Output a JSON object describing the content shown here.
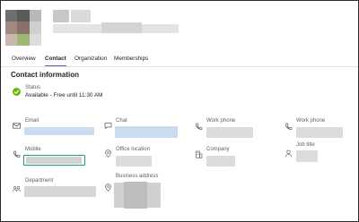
{
  "header": {
    "avatar": {
      "blur_colors": [
        "#6f6f6f",
        "#5a5a5a",
        "#b8b8b8",
        "#a08a80",
        "#8a6f6a",
        "#cfcfcf",
        "#c7b7ad",
        "#9db872",
        "#dcdcdc"
      ]
    },
    "name_blur_color": "#cccccc"
  },
  "tabs": [
    {
      "label": "Overview"
    },
    {
      "label": "Contact",
      "active": true
    },
    {
      "label": "Organization"
    },
    {
      "label": "Memberships"
    }
  ],
  "section": {
    "title": "Contact information"
  },
  "status": {
    "label": "Status",
    "value": "Available - Free until 11:30 AM",
    "color": "#6bb700"
  },
  "fields": {
    "email": {
      "label": "Email",
      "icon": "mail-icon",
      "blur_color": "#c9dcf0"
    },
    "chat": {
      "label": "Chat",
      "icon": "chat-icon",
      "blur_color": "#c9dcf0"
    },
    "work_phone_1": {
      "label": "Work phone",
      "icon": "phone-icon",
      "blur_color": "#dcdcdc"
    },
    "work_phone_2": {
      "label": "Work phone",
      "icon": "phone-icon",
      "blur_color": "#dcdcdc"
    },
    "mobile": {
      "label": "Mobile",
      "icon": "phone-icon",
      "blur_color": "#d2d2d2"
    },
    "office_location": {
      "label": "Office location",
      "icon": "location-icon",
      "blur_color": "#dcdcdc"
    },
    "company": {
      "label": "Company",
      "icon": "building-icon",
      "blur_color": "#dcdcdc"
    },
    "job_title": {
      "label": "Job title",
      "icon": "person-icon",
      "blur_color": "#dcdcdc"
    },
    "department": {
      "label": "Department",
      "icon": "people-icon",
      "blur_color": "#d6d6d6"
    },
    "business_address": {
      "label": "Business address",
      "icon": "location-icon",
      "blur_color": "#d0d0d0"
    }
  },
  "accent": "#5b5fc7",
  "highlight_color": "#1a9a84"
}
